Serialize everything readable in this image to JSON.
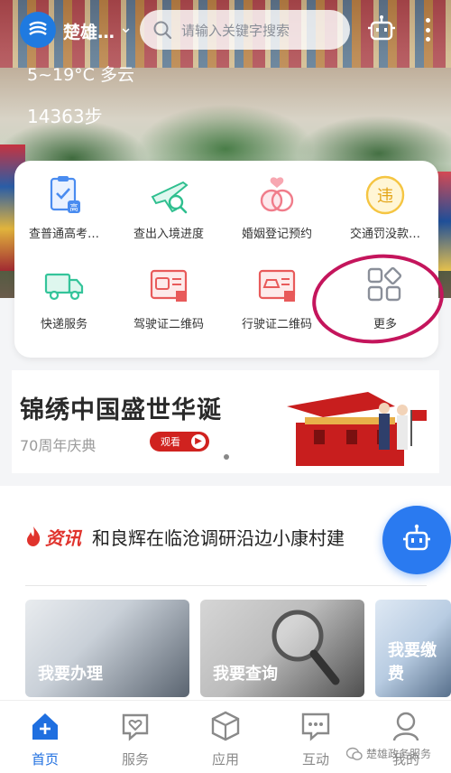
{
  "header": {
    "city": "楚雄…",
    "search_placeholder": "请输入关键字搜索",
    "weather": "5~19°C 多云",
    "steps": "14363步"
  },
  "services": [
    {
      "label": "查普通高考…",
      "icon": "exam-clipboard-icon",
      "color": "#4a8cf0"
    },
    {
      "label": "查出入境进度",
      "icon": "airplane-search-icon",
      "color": "#2fbf8f"
    },
    {
      "label": "婚姻登记预约",
      "icon": "wedding-rings-icon",
      "color": "#f07c8a"
    },
    {
      "label": "交通罚没款…",
      "icon": "traffic-fine-icon",
      "color": "#f5c542"
    },
    {
      "label": "快递服务",
      "icon": "delivery-truck-icon",
      "color": "#34c49a"
    },
    {
      "label": "驾驶证二维码",
      "icon": "driver-license-icon",
      "color": "#e85a5a"
    },
    {
      "label": "行驶证二维码",
      "icon": "vehicle-license-icon",
      "color": "#e85a5a"
    },
    {
      "label": "更多",
      "icon": "more-grid-icon",
      "color": "#8a8f99"
    }
  ],
  "promo": {
    "title": "锦绣中国盛世华诞",
    "subtitle": "70周年庆典",
    "button": "观看"
  },
  "news": {
    "tag": "资讯",
    "headline": "和良辉在临沧调研沿边小康村建"
  },
  "tiles": [
    {
      "label": "我要办理"
    },
    {
      "label": "我要查询"
    },
    {
      "label": "我要缴费"
    }
  ],
  "tabs": [
    {
      "label": "首页",
      "active": true
    },
    {
      "label": "服务",
      "active": false
    },
    {
      "label": "应用",
      "active": false
    },
    {
      "label": "互动",
      "active": false
    },
    {
      "label": "我的",
      "active": false
    }
  ],
  "watermark": "楚雄政务服务",
  "colors": {
    "primary": "#1f6fe0",
    "accent": "#d0221f",
    "highlight_ring": "#c4155c"
  }
}
